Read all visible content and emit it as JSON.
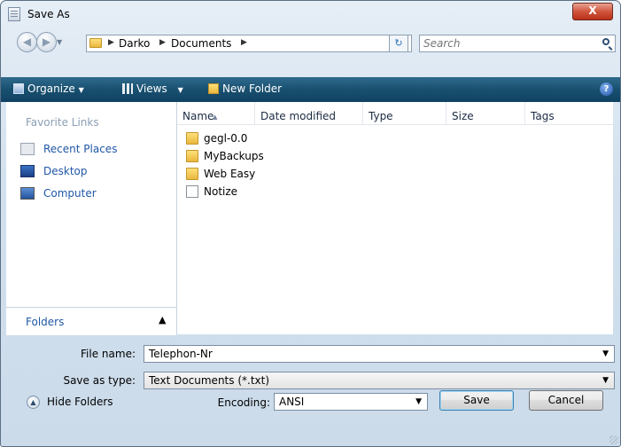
{
  "window": {
    "title": "Save As",
    "close_label": "X"
  },
  "nav": {
    "breadcrumb": [
      "Darko",
      "Documents"
    ],
    "search_placeholder": "Search"
  },
  "toolbar": {
    "organize": "Organize",
    "views": "Views",
    "new_folder": "New Folder",
    "help": "?"
  },
  "favorites": {
    "title": "Favorite Links",
    "items": [
      "Recent Places",
      "Desktop",
      "Computer"
    ],
    "folders_label": "Folders"
  },
  "columns": [
    "Name",
    "Date modified",
    "Type",
    "Size",
    "Tags"
  ],
  "files": [
    {
      "name": "gegl-0.0",
      "kind": "folder"
    },
    {
      "name": "MyBackups",
      "kind": "folder"
    },
    {
      "name": "Web Easy",
      "kind": "folder"
    },
    {
      "name": "Notize",
      "kind": "document"
    }
  ],
  "form": {
    "file_name_label": "File name:",
    "file_name_value": "Telephon-Nr",
    "save_type_label": "Save as type:",
    "save_type_value": "Text Documents (*.txt)",
    "encoding_label": "Encoding:",
    "encoding_value": "ANSI"
  },
  "buttons": {
    "hide_folders": "Hide Folders",
    "save": "Save",
    "cancel": "Cancel"
  }
}
